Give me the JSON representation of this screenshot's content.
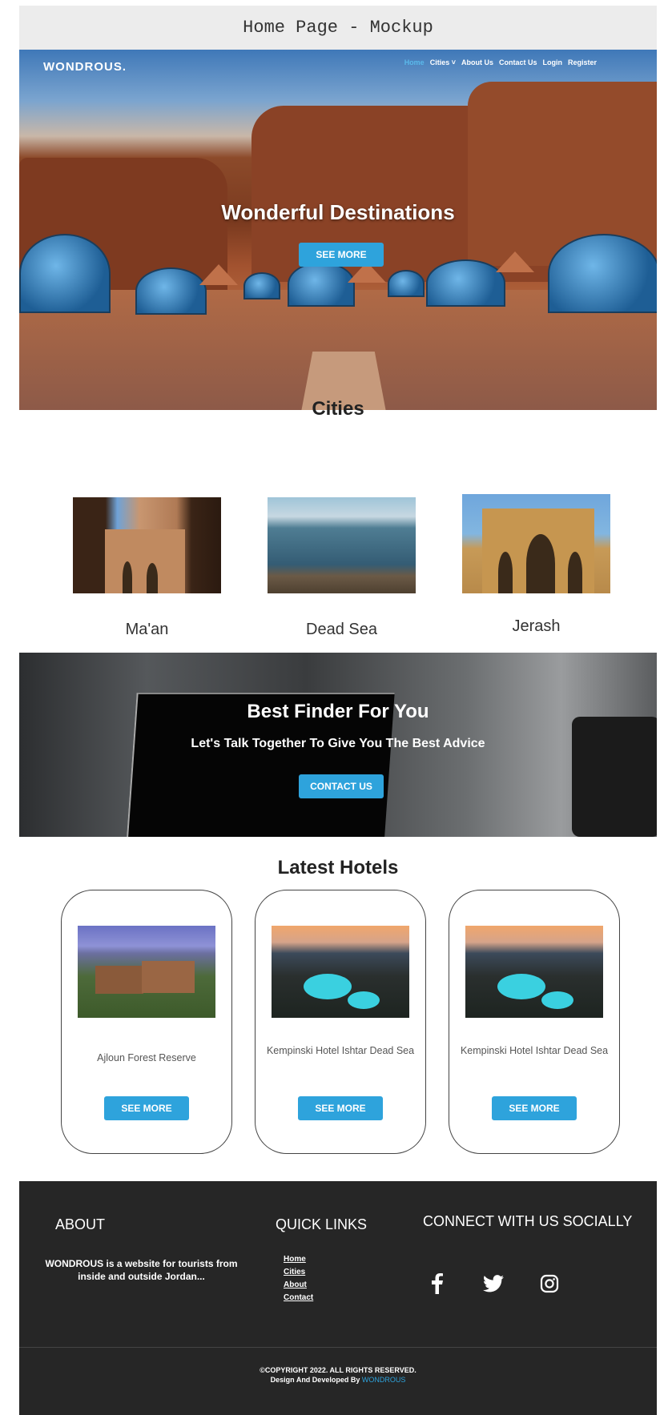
{
  "mockup_label": "Home Page - Mockup",
  "brand": {
    "logo": "WONDROUS."
  },
  "nav": {
    "items": [
      "Home",
      "Cities ˅",
      "About Us",
      "Contact Us",
      "Login",
      "Register"
    ]
  },
  "hero": {
    "title": "Wonderful Destinations",
    "button": "SEE MORE"
  },
  "cities": {
    "title": "Cities",
    "items": [
      {
        "name": "Ma'an"
      },
      {
        "name": "Dead Sea"
      },
      {
        "name": "Jerash"
      }
    ]
  },
  "finder": {
    "title": "Best Finder For You",
    "subtitle": "Let's Talk Together To Give You The Best Advice",
    "button": "CONTACT US"
  },
  "hotels": {
    "title": "Latest Hotels",
    "items": [
      {
        "name": "Ajloun Forest Reserve",
        "button": "SEE MORE"
      },
      {
        "name": "Kempinski Hotel Ishtar Dead Sea",
        "button": "SEE MORE"
      },
      {
        "name": "Kempinski Hotel Ishtar Dead Sea",
        "button": "SEE MORE"
      }
    ]
  },
  "footer": {
    "about_title": "ABOUT",
    "about_text": "WONDROUS is a website for tourists from inside and outside Jordan...",
    "quick_title": "QUICK LINKS",
    "quick_links": [
      "Home",
      "Cities",
      "About",
      "Contact"
    ],
    "social_title": "CONNECT WITH US SOCIALLY",
    "social_icons": [
      "facebook-icon",
      "twitter-icon",
      "instagram-icon"
    ],
    "copyright": "©COPYRIGHT 2022. ALL RIGHTS RESERVED.",
    "credit_prefix": "Design And Developed By",
    "credit_brand": "WONDROUS"
  },
  "colors": {
    "accent": "#2ea3dc",
    "footer_bg": "#262626"
  }
}
